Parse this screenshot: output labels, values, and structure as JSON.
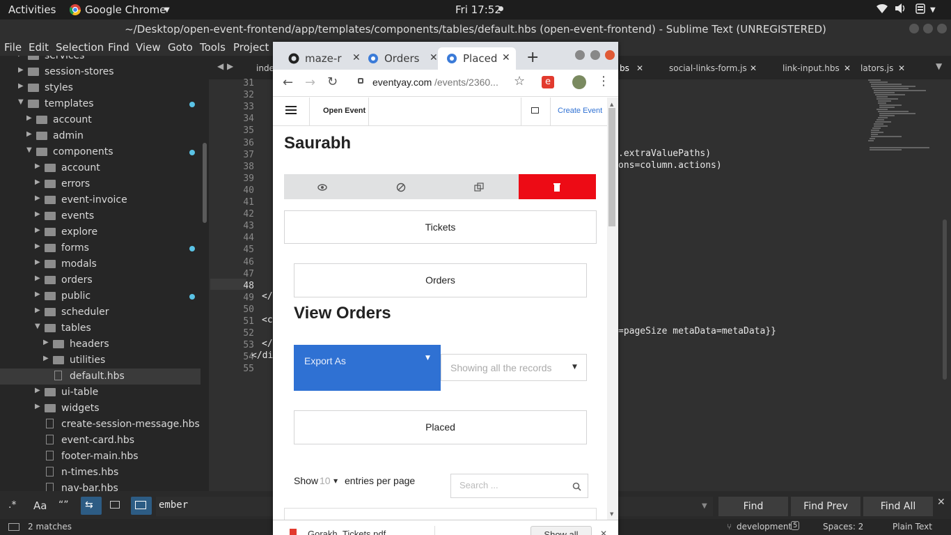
{
  "topbar": {
    "activities": "Activities",
    "app_name": "Google Chrome",
    "clock": "Fri 17:52"
  },
  "sublime": {
    "title": "~/Desktop/open-event-frontend/app/templates/components/tables/default.hbs (open-event-frontend) - Sublime Text (UNREGISTERED)",
    "menu": [
      "File",
      "Edit",
      "Selection",
      "Find",
      "View",
      "Goto",
      "Tools",
      "Project"
    ],
    "sidebar": [
      {
        "label": "services",
        "type": "folder",
        "indent": 2,
        "open": false
      },
      {
        "label": "session-stores",
        "type": "folder",
        "indent": 2,
        "open": false
      },
      {
        "label": "styles",
        "type": "folder",
        "indent": 2,
        "open": false
      },
      {
        "label": "templates",
        "type": "folder",
        "indent": 2,
        "open": true,
        "dot": true
      },
      {
        "label": "account",
        "type": "folder",
        "indent": 3,
        "open": false
      },
      {
        "label": "admin",
        "type": "folder",
        "indent": 3,
        "open": false
      },
      {
        "label": "components",
        "type": "folder",
        "indent": 3,
        "open": true,
        "dot": true
      },
      {
        "label": "account",
        "type": "folder",
        "indent": 4,
        "open": false
      },
      {
        "label": "errors",
        "type": "folder",
        "indent": 4,
        "open": false
      },
      {
        "label": "event-invoice",
        "type": "folder",
        "indent": 4,
        "open": false
      },
      {
        "label": "events",
        "type": "folder",
        "indent": 4,
        "open": false
      },
      {
        "label": "explore",
        "type": "folder",
        "indent": 4,
        "open": false
      },
      {
        "label": "forms",
        "type": "folder",
        "indent": 4,
        "open": false,
        "dot": true
      },
      {
        "label": "modals",
        "type": "folder",
        "indent": 4,
        "open": false
      },
      {
        "label": "orders",
        "type": "folder",
        "indent": 4,
        "open": false
      },
      {
        "label": "public",
        "type": "folder",
        "indent": 4,
        "open": false,
        "dot": true
      },
      {
        "label": "scheduler",
        "type": "folder",
        "indent": 4,
        "open": false
      },
      {
        "label": "tables",
        "type": "folder",
        "indent": 4,
        "open": true
      },
      {
        "label": "headers",
        "type": "folder",
        "indent": 5,
        "open": false
      },
      {
        "label": "utilities",
        "type": "folder",
        "indent": 5,
        "open": false
      },
      {
        "label": "default.hbs",
        "type": "file",
        "indent": 5,
        "selected": true
      },
      {
        "label": "ui-table",
        "type": "folder",
        "indent": 4,
        "open": false
      },
      {
        "label": "widgets",
        "type": "folder",
        "indent": 4,
        "open": false
      },
      {
        "label": "create-session-message.hbs",
        "type": "file",
        "indent": 4
      },
      {
        "label": "event-card.hbs",
        "type": "file",
        "indent": 4
      },
      {
        "label": "footer-main.hbs",
        "type": "file",
        "indent": 4
      },
      {
        "label": "n-times.hbs",
        "type": "file",
        "indent": 4
      },
      {
        "label": "nav-bar.hbs",
        "type": "file",
        "indent": 4
      }
    ],
    "tabs": [
      "inde",
      "bs",
      "social-links-form.js",
      "link-input.hbs",
      "lators.js"
    ],
    "line_numbers": [
      "31",
      "32",
      "33",
      "34",
      "35",
      "36",
      "37",
      "38",
      "39",
      "40",
      "41",
      "42",
      "43",
      "44",
      "45",
      "46",
      "47",
      "48",
      "49",
      "50",
      "51",
      "52",
      "53",
      "54",
      "55"
    ],
    "code_right": [
      ".extraValuePaths)",
      "ons=column.actions)",
      "=pageSize metaData=metaData}}"
    ],
    "code_left": [
      "</",
      "<c",
      "</",
      "</di"
    ],
    "find": {
      "value": "ember",
      "find_label": "Find",
      "find_prev_label": "Find Prev",
      "find_all_label": "Find All"
    },
    "status": {
      "matches": "2 matches",
      "branch": "development",
      "branch_count": "5",
      "spaces": "Spaces: 2",
      "syntax": "Plain Text"
    }
  },
  "chrome": {
    "tabs": [
      "maze-r",
      "Orders",
      "Placed"
    ],
    "url_host": "eventyay.com",
    "url_path": "/events/2360...",
    "nav": {
      "brand": "Open Event",
      "create": "Create Event"
    },
    "page": {
      "user_name": "Saurabh",
      "tickets_label": "Tickets",
      "orders_label": "Orders",
      "heading": "View Orders",
      "export_label": "Export As",
      "filter_label": "Showing all the records",
      "placed_label": "Placed",
      "show_label": "Show",
      "entries_count": "10",
      "entries_suffix": "entries per page",
      "search_placeholder": "Search ..."
    },
    "download": {
      "file": "Gorakh_Tickets.pdf",
      "show_all": "Show all"
    }
  },
  "colors": {
    "accent_blue": "#2f71d3",
    "danger_red": "#ed0b15",
    "sublime_dot": "#5ac3e6"
  }
}
